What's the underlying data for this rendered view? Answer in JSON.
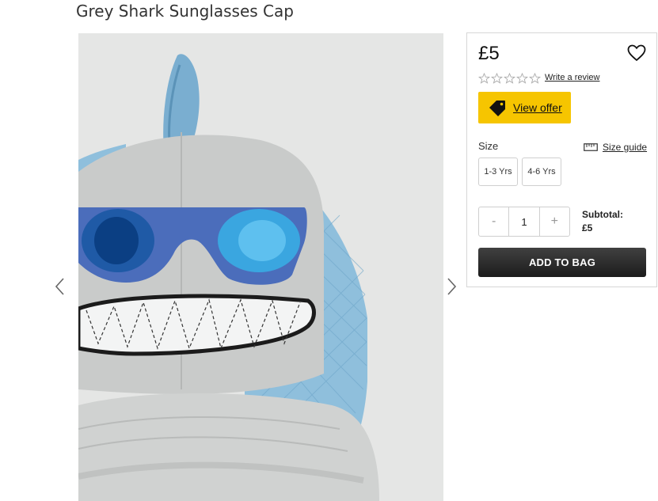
{
  "product": {
    "title": "Grey Shark Sunglasses Cap"
  },
  "gallery": {
    "image": "grey-shark-sunglasses-cap-photo",
    "prev_icon": "chevron-left-icon",
    "next_icon": "chevron-right-icon"
  },
  "purchase": {
    "price": "£5",
    "wishlist_icon": "heart-icon",
    "rating": {
      "stars_filled": 0,
      "stars_total": 5,
      "review_link": "Write a review"
    },
    "offer": {
      "label": "View offer",
      "icon": "tag-icon",
      "color": "#f6c500"
    },
    "size": {
      "label": "Size",
      "guide_label": "Size guide",
      "guide_icon": "ruler-icon",
      "options": [
        "1-3 Yrs",
        "4-6 Yrs"
      ]
    },
    "quantity": {
      "decrement": "-",
      "value": "1",
      "increment": "+"
    },
    "subtotal": {
      "label": "Subtotal:",
      "value": "£5"
    },
    "add_to_bag": "ADD TO BAG"
  }
}
